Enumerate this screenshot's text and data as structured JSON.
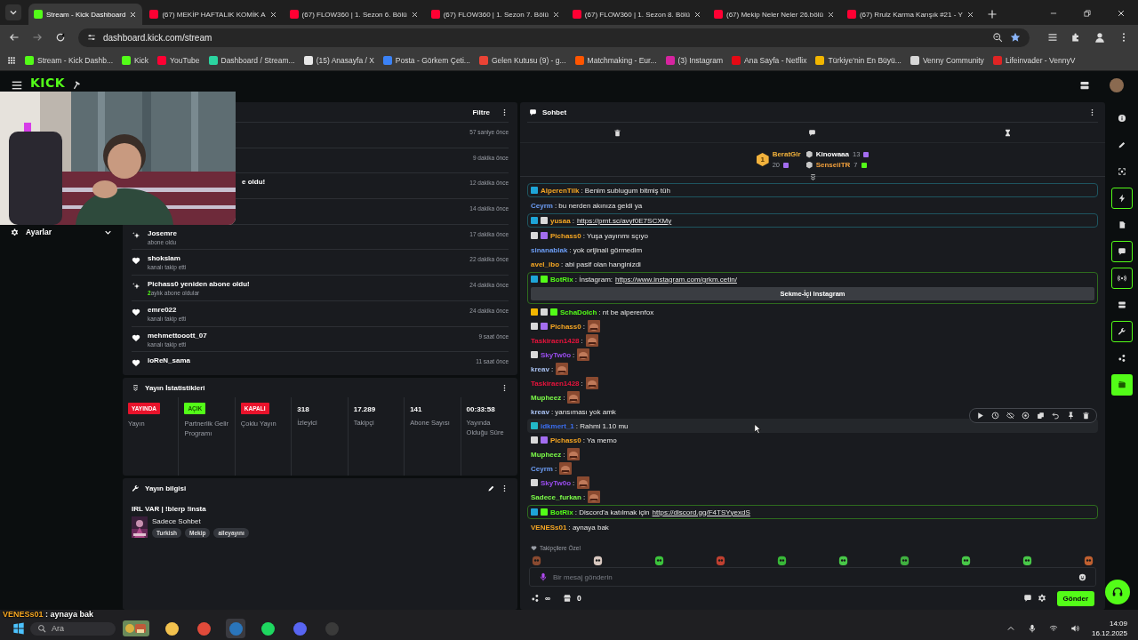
{
  "browser": {
    "tabs": [
      {
        "title": "Stream - Kick Dashboard",
        "kind": "kick",
        "selected": true
      },
      {
        "title": "(67) MEKİP HAFTALIK KOMİK A",
        "kind": "youtube",
        "selected": false
      },
      {
        "title": "(67) FLOW360 | 1. Sezon 6. Bölü",
        "kind": "youtube",
        "selected": false
      },
      {
        "title": "(67) FLOW360 | 1. Sezon 7. Bölü",
        "kind": "youtube",
        "selected": false
      },
      {
        "title": "(67) FLOW360 | 1. Sezon 8. Bölü",
        "kind": "youtube",
        "selected": false
      },
      {
        "title": "(67) Mekip Neler Neler 26.bölü",
        "kind": "youtube",
        "selected": false
      },
      {
        "title": "(67) Rrulz Karma Karışık #21 - Y",
        "kind": "youtube",
        "selected": false
      }
    ],
    "address": "dashboard.kick.com/stream",
    "bookmarks": [
      {
        "label": "Stream - Kick Dashb...",
        "kind": "kick"
      },
      {
        "label": "Kick",
        "kind": "kick"
      },
      {
        "label": "YouTube",
        "kind": "youtube"
      },
      {
        "label": "Dashboard / Stream...",
        "kind": "dash"
      },
      {
        "label": "(15) Anasayfa / X",
        "kind": "x"
      },
      {
        "label": "Posta - Görkem Çeti...",
        "kind": "mail"
      },
      {
        "label": "Gelen Kutusu (9) - g...",
        "kind": "gmail"
      },
      {
        "label": "Matchmaking - Eur...",
        "kind": "faceit"
      },
      {
        "label": "(3) Instagram",
        "kind": "instagram"
      },
      {
        "label": "Ana Sayfa - Netflix",
        "kind": "netflix"
      },
      {
        "label": "Türkiye'nin En Büyü...",
        "kind": "crown"
      },
      {
        "label": "Venny Community",
        "kind": "venny"
      },
      {
        "label": "Lifeinvader - VennyV",
        "kind": "life"
      }
    ]
  },
  "logo": "KICK",
  "sidebar": {
    "items": [
      {
        "label": "Ayarlar",
        "expanded": false
      }
    ]
  },
  "activity": {
    "filter": "Filtre",
    "events": [
      {
        "kind": "covered",
        "time": "57 saniye önce"
      },
      {
        "kind": "covered",
        "time": "9 dakika önce"
      },
      {
        "kind": "covered",
        "name": "e oldu!",
        "time": "12 dakika önce"
      },
      {
        "kind": "covered",
        "time": "14 dakika önce"
      },
      {
        "kind": "sub",
        "name": "Josemre",
        "detail": "abone oldu",
        "time": "17 dakika önce"
      },
      {
        "kind": "follow",
        "name": "shokslam",
        "detail": "kanalı takip etti",
        "time": "22 dakika önce"
      },
      {
        "kind": "sub",
        "name": "Pichass0 yeniden abone oldu!",
        "count": "2",
        "detail": "aylık abone oldular",
        "time": "24 dakika önce"
      },
      {
        "kind": "follow",
        "name": "emre022",
        "detail": "kanalı takip etti",
        "time": "24 dakika önce"
      },
      {
        "kind": "follow",
        "name": "mehmettooott_07",
        "detail": "kanalı takip etti",
        "time": "9 saat önce"
      },
      {
        "kind": "follow",
        "name": "loReN_sama",
        "time": "11 saat önce"
      }
    ]
  },
  "stats": {
    "title": "Yayın İstatistikleri",
    "items": [
      {
        "kind": "status",
        "value": "YAYINDA",
        "color": "#e8132b",
        "label": "Yayın"
      },
      {
        "kind": "status",
        "value": "AÇIK",
        "color": "#53fc18",
        "label": "Partnerlik Gelir Programı"
      },
      {
        "kind": "status",
        "value": "KAPALI",
        "color": "#e8132b",
        "label": "Çoklu Yayın"
      },
      {
        "kind": "number",
        "value": "318",
        "label": "İzleyici"
      },
      {
        "kind": "number",
        "value": "17.289",
        "label": "Takipçi"
      },
      {
        "kind": "number",
        "value": "141",
        "label": "Abone Sayısı"
      },
      {
        "kind": "number",
        "value": "00:33:58",
        "label": "Yayında Olduğu Süre"
      }
    ]
  },
  "info": {
    "title": "Yayın bilgisi",
    "stream_title": "IRL VAR | !blerp !insta",
    "category": "Sadece Sohbet",
    "tags": [
      "Turkish",
      "Mekip",
      "aileyayını"
    ]
  },
  "chat": {
    "title": "Sohbet",
    "leaderboard": [
      {
        "rank": "1",
        "name": "BeratGlr",
        "count": "20",
        "color": "#f2b23c",
        "badge": {
          "kind": "sub"
        }
      },
      {
        "name": "Kinowaaa",
        "count": "13",
        "color": "#ffffff",
        "badge": {
          "kind": "sub"
        }
      },
      {
        "name": "SenseiiTR",
        "count": "7",
        "color": "#f2a03c",
        "badge": {
          "kind": "sub_green"
        }
      }
    ],
    "messages": [
      {
        "kind": "text",
        "user": "AlperenTilk",
        "color": "#f5a623",
        "badges": [
          {
            "kind": "mod"
          }
        ],
        "text": ": Benim sublugum bitmiş tüh",
        "box": {
          "kind": "mod"
        },
        "hovered": false
      },
      {
        "kind": "text",
        "user": "Ceyrm",
        "color": "#6c9df5",
        "text": ": bu nerden akınıza geldi ya",
        "hovered": false
      },
      {
        "kind": "text",
        "user": "yusaa",
        "color": "#f5a623",
        "badges": [
          {
            "kind": "mod"
          },
          {
            "kind": "avatar"
          }
        ],
        "text": ":",
        "link": "https://prnt.sc/avyf0E7SCXMy",
        "box": {
          "kind": "mod"
        },
        "hovered": false
      },
      {
        "kind": "text",
        "user": "Pichass0",
        "color": "#f5a623",
        "badges": [
          {
            "kind": "avatar"
          },
          {
            "kind": "sub"
          }
        ],
        "text": ": Yuşa yayınmı sçıyo",
        "hovered": false
      },
      {
        "kind": "text",
        "user": "sinanablak",
        "color": "#6c9df5",
        "text": ": yok orijinali görmedim",
        "hovered": false
      },
      {
        "kind": "text",
        "user": "avel_ibo",
        "color": "#f5a623",
        "text": ": abi pasif olan hanginizdi",
        "hovered": false
      },
      {
        "kind": "text",
        "user": "BotRix",
        "color": "#53fc18",
        "badges": [
          {
            "kind": "mod"
          },
          {
            "kind": "verified"
          }
        ],
        "text": ": İnstagram:",
        "link": "https://www.instagram.com/grkm.cetin/",
        "box": {
          "kind": "bot"
        },
        "button": "Sekme-İçi Instagram",
        "hovered": false
      },
      {
        "kind": "text",
        "user": "SchaDolch",
        "color": "#53fc18",
        "badges": [
          {
            "kind": "gifter"
          },
          {
            "kind": "avatar"
          },
          {
            "kind": "sub_green"
          }
        ],
        "text": ": nt be alperenfox",
        "hovered": false
      },
      {
        "kind": "emote",
        "user": "Pichass0",
        "color": "#f5a623",
        "badges": [
          {
            "kind": "avatar"
          },
          {
            "kind": "sub"
          }
        ],
        "text": ":",
        "hovered": false
      },
      {
        "kind": "emote",
        "user": "Taskiraen1428",
        "color": "#e8133c",
        "text": ":",
        "hovered": false
      },
      {
        "kind": "emote",
        "user": "SkyTw0o",
        "color": "#9b4df0",
        "badges": [
          {
            "kind": "avatar"
          }
        ],
        "text": ":",
        "hovered": false
      },
      {
        "kind": "emote",
        "user": "kreav",
        "color": "#a8c0f0",
        "text": ":",
        "hovered": false
      },
      {
        "kind": "emote",
        "user": "Taskiraen1428",
        "color": "#e8133c",
        "text": ":",
        "hovered": false
      },
      {
        "kind": "emote",
        "user": "Mupheez",
        "color": "#7cfc48",
        "text": ":",
        "hovered": false
      },
      {
        "kind": "text",
        "user": "kreav",
        "color": "#a8c0f0",
        "text": ": yansıması yok amk",
        "hovered": false
      },
      {
        "kind": "text",
        "user": "idkmert_1",
        "color": "#3b6ef0",
        "badges": [
          {
            "kind": "og"
          }
        ],
        "text": ": Rahmi 1.10 mu",
        "hovered": true
      },
      {
        "kind": "text",
        "user": "Pichass0",
        "color": "#f5a623",
        "badges": [
          {
            "kind": "avatar"
          },
          {
            "kind": "sub"
          }
        ],
        "text": ": Ya memo",
        "hovered": false
      },
      {
        "kind": "emote",
        "user": "Mupheez",
        "color": "#7cfc48",
        "text": ":",
        "hovered": false
      },
      {
        "kind": "emote",
        "user": "Ceyrm",
        "color": "#6c9df5",
        "text": ":",
        "hovered": false
      },
      {
        "kind": "emote",
        "user": "SkyTw0o",
        "color": "#9b4df0",
        "badges": [
          {
            "kind": "avatar"
          }
        ],
        "text": ":",
        "hovered": false
      },
      {
        "kind": "emote",
        "user": "Sadece_furkan",
        "color": "#7cfc48",
        "text": ":",
        "hovered": false
      },
      {
        "kind": "text",
        "user": "BotRix",
        "color": "#53fc18",
        "badges": [
          {
            "kind": "mod"
          },
          {
            "kind": "verified"
          }
        ],
        "text": ": Discord'a katılmak için",
        "link": "https://discord.gg/F4TSYyexdS",
        "box": {
          "kind": "bot"
        },
        "hovered": false
      },
      {
        "kind": "text",
        "user": "VENESs01",
        "color": "#f5a623",
        "text": ": aynaya bak",
        "hovered": false
      }
    ],
    "emote_section": "Takipçilere Özel",
    "input": {
      "placeholder": "Bir mesaj gönderin"
    },
    "points": "∞",
    "store": "0",
    "send": "Gönder"
  },
  "rail": [
    {
      "kind": "info",
      "on": false
    },
    {
      "kind": "pencil",
      "on": false
    },
    {
      "kind": "focus",
      "on": false
    },
    {
      "kind": "bolt",
      "on": true
    },
    {
      "kind": "note",
      "on": false
    },
    {
      "kind": "chat",
      "on": true
    },
    {
      "kind": "broadcast",
      "on": true
    },
    {
      "kind": "video",
      "on": false
    },
    {
      "kind": "wrench",
      "on": true
    },
    {
      "kind": "share",
      "on": false
    },
    {
      "kind": "film",
      "on": true
    }
  ],
  "taskbar": {
    "overlay_user": "VENESs01",
    "overlay_text": ": aynaya bak",
    "search": "Ara",
    "time": "14:09",
    "date": "16.12.2025"
  }
}
